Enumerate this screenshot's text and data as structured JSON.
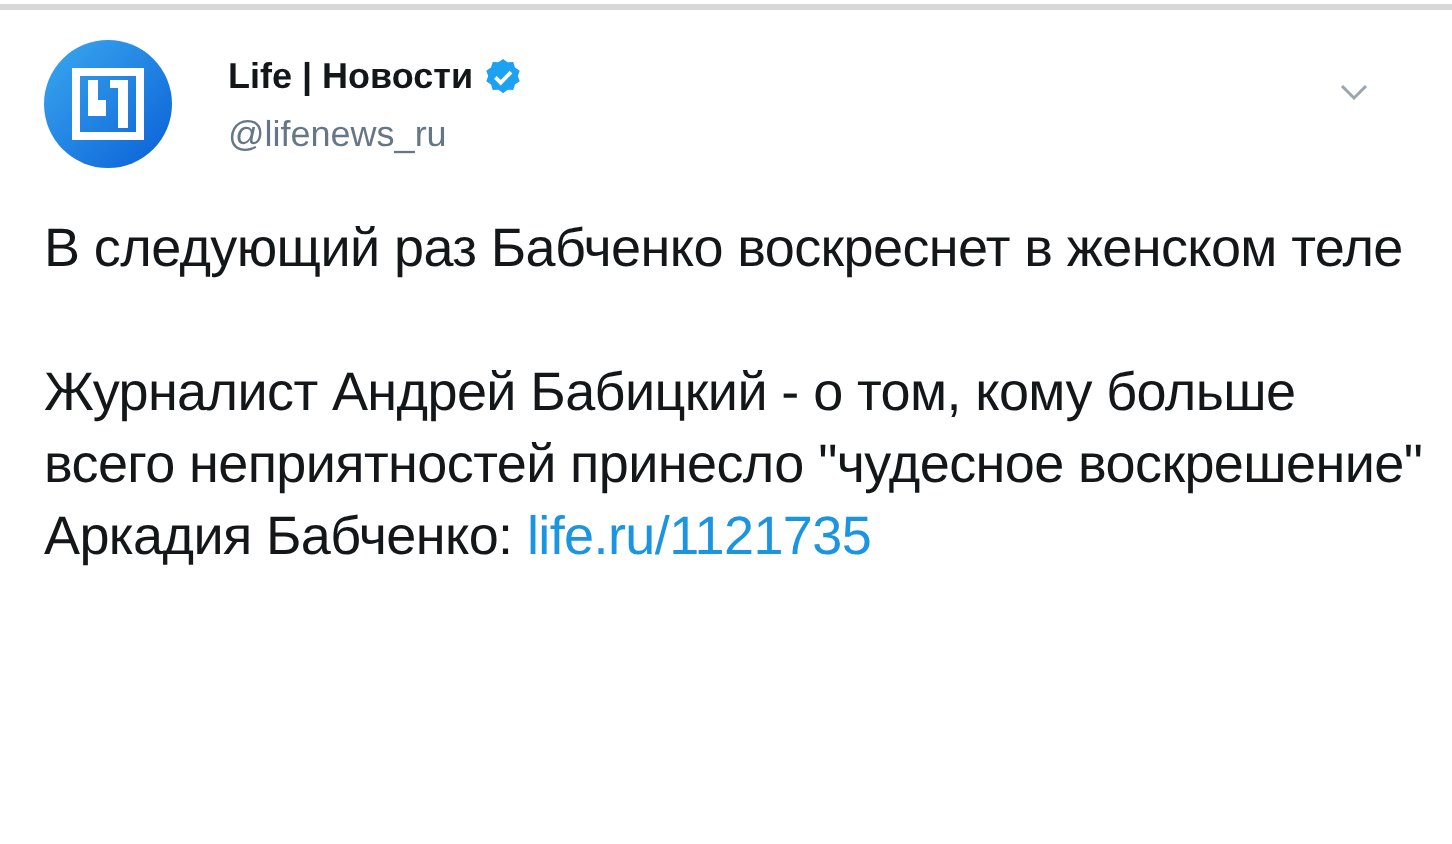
{
  "author": {
    "name": "Life | Новости",
    "verified": true,
    "handle": "@lifenews_ru"
  },
  "paragraphs": [
    {
      "text": "В следующий раз Бабченко воскреснет в женском теле"
    },
    {
      "text": "Журналист Андрей Бабицкий - о том, кому больше всего неприятностей принесло \"чудесное воскрешение\" Аркадия Бабченко: ",
      "link": "life.ru/1121735"
    }
  ]
}
